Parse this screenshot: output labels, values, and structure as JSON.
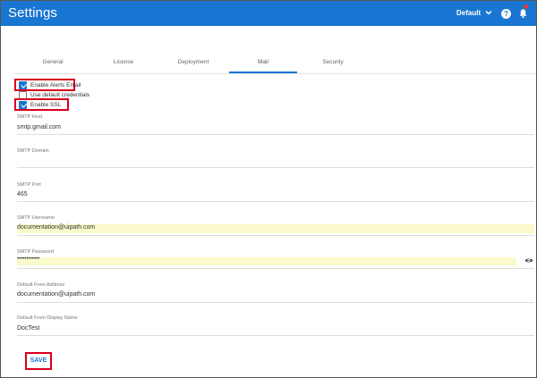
{
  "header": {
    "title": "Settings",
    "tenant": "Default",
    "help_glyph": "?",
    "accent": "#1976d2"
  },
  "tabs": [
    {
      "label": "General",
      "active": false
    },
    {
      "label": "License",
      "active": false
    },
    {
      "label": "Deployment",
      "active": false
    },
    {
      "label": "Mail",
      "active": true
    },
    {
      "label": "Security",
      "active": false
    }
  ],
  "checkboxes": {
    "enable_alerts_email": {
      "label": "Enable Alerts Email",
      "checked": true
    },
    "use_default_credentials": {
      "label": "Use default credentials",
      "checked": false
    },
    "enable_ssl": {
      "label": "Enable SSL",
      "checked": true
    }
  },
  "fields": {
    "smtp_host": {
      "label": "SMTP Host",
      "value": "smtp.gmail.com"
    },
    "smtp_domain": {
      "label": "SMTP Domain",
      "value": ""
    },
    "smtp_port": {
      "label": "SMTP Port",
      "value": "465"
    },
    "smtp_username": {
      "label": "SMTP Username",
      "value": "documentation@uipath.com"
    },
    "smtp_password": {
      "label": "SMTP Password",
      "value": "••••••••••••"
    },
    "default_from_address": {
      "label": "Default From Address",
      "value": "documentation@uipath.com"
    },
    "default_from_display_name": {
      "label": "Default From Display Name",
      "value": "DocTest"
    }
  },
  "save_label": "SAVE",
  "colors": {
    "highlight": "#d9001b",
    "autofill": "#fafacb",
    "notification_dot": "#e53935"
  }
}
